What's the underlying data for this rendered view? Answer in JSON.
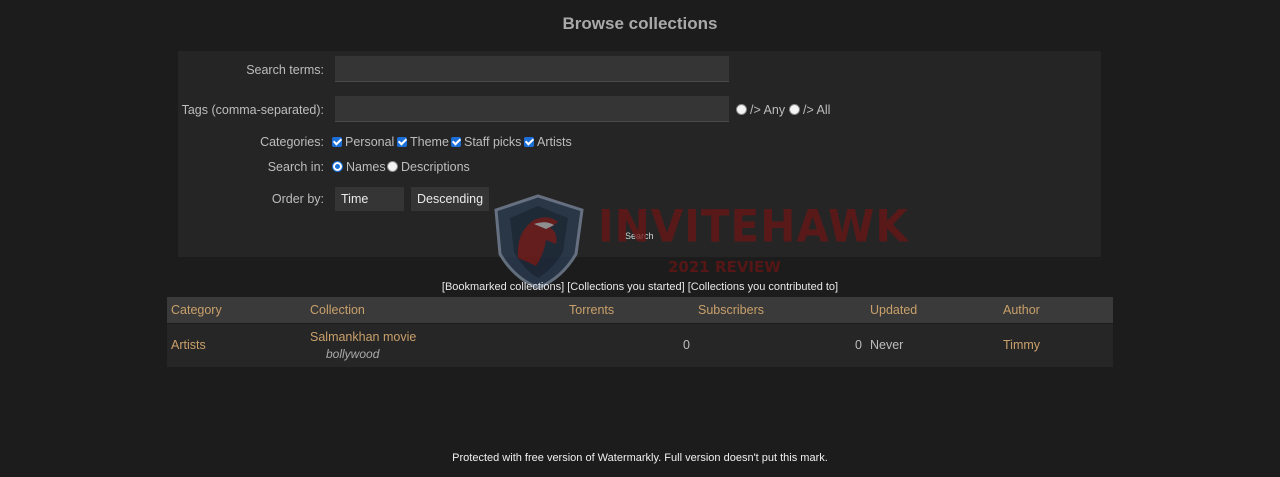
{
  "page": {
    "title": "Browse collections"
  },
  "form": {
    "search_terms_label": "Search terms:",
    "search_terms_value": "",
    "tags_label": "Tags (comma-separated):",
    "tags_value": "",
    "tag_match_any": "/> Any",
    "tag_match_all": "/> All",
    "categories_label": "Categories:",
    "categories": [
      {
        "label": "Personal",
        "checked": true
      },
      {
        "label": "Theme",
        "checked": true
      },
      {
        "label": "Staff picks",
        "checked": true
      },
      {
        "label": "Artists",
        "checked": true
      }
    ],
    "search_in_label": "Search in:",
    "search_in_names": "Names",
    "search_in_descriptions": "Descriptions",
    "search_in_selected": "Names",
    "order_by_label": "Order by:",
    "order_by_value": "Time",
    "order_dir_value": "Descending",
    "search_button": "Search"
  },
  "watermark": {
    "brand": "INVITEHAWK",
    "subtitle": "2021 REVIEW",
    "icon": "hawk-shield-icon"
  },
  "links": {
    "bookmarked": "[Bookmarked collections]",
    "started": "[Collections you started]",
    "contributed": "[Collections you contributed to]"
  },
  "table": {
    "headers": [
      "Category",
      "Collection",
      "Torrents",
      "Subscribers",
      "Updated",
      "Author"
    ],
    "rows": [
      {
        "category": "Artists",
        "collection": "Salmankhan movie",
        "tags": "bollywood",
        "torrents": "0",
        "subscribers": "0",
        "updated": "Never",
        "author": "Timmy"
      }
    ]
  },
  "footer": {
    "note": "Protected with free version of Watermarkly. Full version doesn't put this mark."
  },
  "colors": {
    "background": "#1c1c1c",
    "panel": "#252525",
    "link": "#c9a06a",
    "checkbox_accent": "#1b6fd9",
    "watermark_red": "#6e1515"
  }
}
